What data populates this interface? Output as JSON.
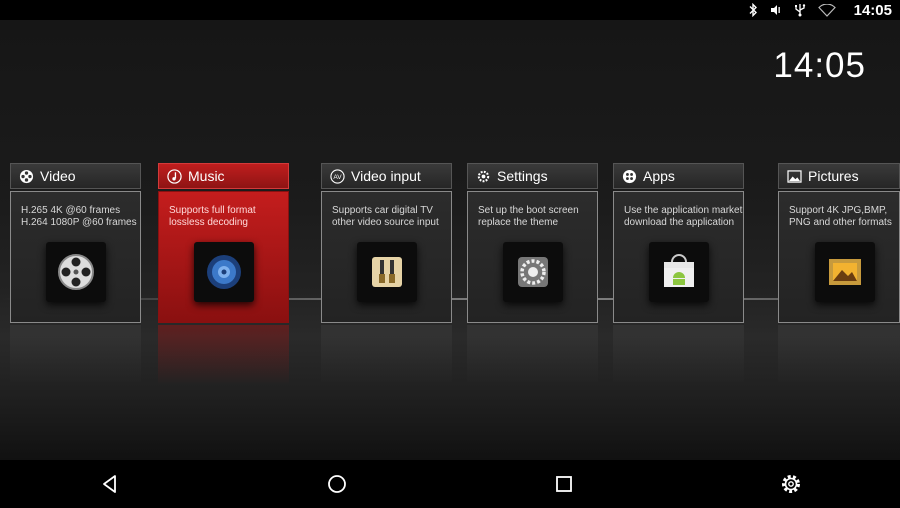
{
  "status": {
    "time": "14:05",
    "icons": [
      "bluetooth-icon",
      "volume-mute-icon",
      "usb-icon",
      "wifi-icon"
    ]
  },
  "clock": "14:05",
  "cards": [
    {
      "title": "Video",
      "desc": "H.265 4K @60 frames\nH.264 1080P @60 frames",
      "icon": "film-reel-icon"
    },
    {
      "title": "Music",
      "desc": "Supports full format\nlossless decoding",
      "icon": "speaker-icon",
      "active": true
    },
    {
      "title": "Video input",
      "desc": "Supports car digital TV\nother video source input",
      "icon": "av-cable-icon"
    },
    {
      "title": "Settings",
      "desc": "Set up the boot screen\nreplace the theme",
      "icon": "gear-wheel-icon"
    },
    {
      "title": "Apps",
      "desc": "Use the application market\ndownload the application",
      "icon": "android-market-icon"
    },
    {
      "title": "Pictures",
      "desc": "Support 4K JPG,BMP,\nPNG and other formats",
      "icon": "picture-icon"
    }
  ],
  "navbar": [
    "back-icon",
    "home-icon",
    "recents-icon",
    "settings-icon"
  ],
  "colors": {
    "accent": "#c41d1d",
    "background": "#1b1b1b"
  }
}
